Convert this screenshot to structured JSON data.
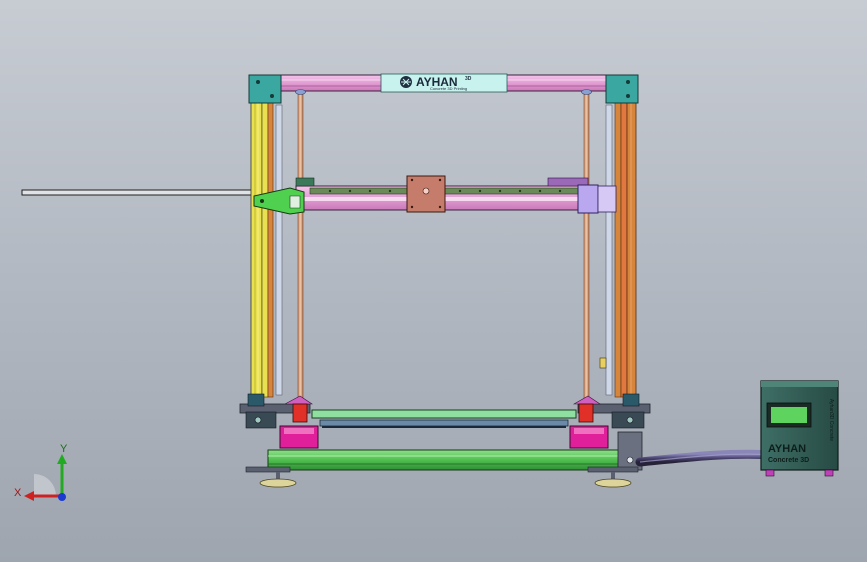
{
  "frame_logo": {
    "brand": "AYHAN",
    "sup": "3D",
    "tagline": "Concrete 3D Printing"
  },
  "controller": {
    "brand": "AYHAN",
    "model": "Concrete 3D",
    "side_label": "Ayhan3D Concrete"
  },
  "triad": {
    "x_label": "X",
    "y_label": "Y"
  },
  "colors": {
    "background": "#b4bac3",
    "frame_pink": "#e8a4d8",
    "frame_yellow": "#e8e050",
    "frame_orange": "#d8853c",
    "corner_teal": "#3aa7a0",
    "base_green": "#4fbf4f",
    "motor_magenta": "#e0209a",
    "controller_teal": "#2e5a52",
    "lcd_green": "#5ed35e"
  },
  "icons": {
    "triad": "axis-triad-icon"
  }
}
